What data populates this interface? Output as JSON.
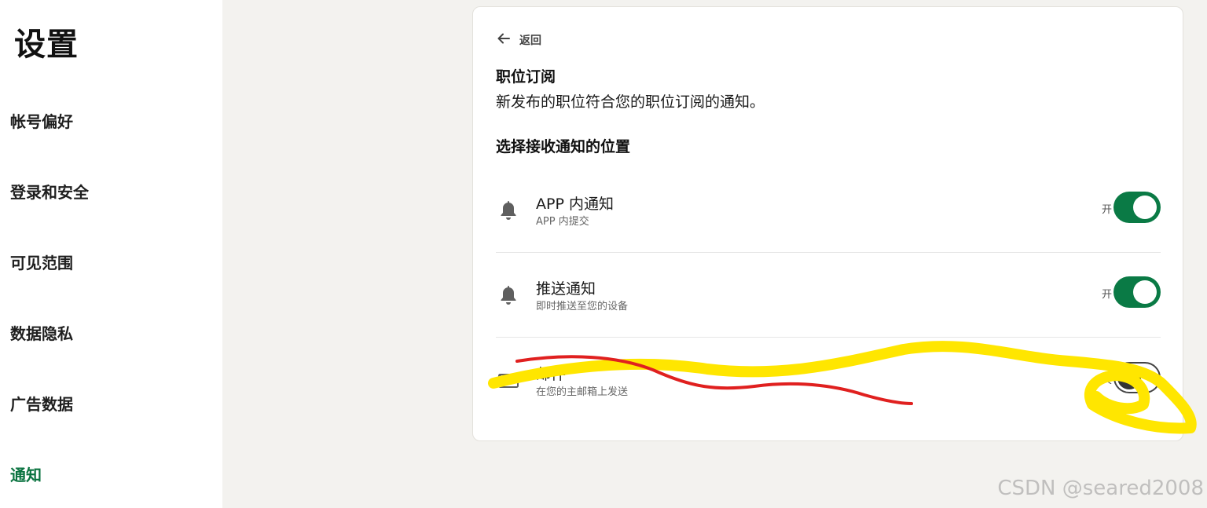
{
  "sidebar": {
    "title": "设置",
    "items": [
      {
        "label": "帐号偏好"
      },
      {
        "label": "登录和安全"
      },
      {
        "label": "可见范围"
      },
      {
        "label": "数据隐私"
      },
      {
        "label": "广告数据"
      },
      {
        "label": "通知",
        "active": true
      }
    ]
  },
  "card": {
    "back_label": "返回",
    "section_title": "职位订阅",
    "section_desc": "新发布的职位符合您的职位订阅的通知。",
    "choose_title": "选择接收通知的位置",
    "rows": [
      {
        "icon": "bell-icon",
        "title": "APP 内通知",
        "subtitle": "APP 内提交",
        "toggle_label": "开",
        "on": true
      },
      {
        "icon": "bell-icon",
        "title": "推送通知",
        "subtitle": "即时推送至您的设备",
        "toggle_label": "开",
        "on": true
      },
      {
        "icon": "mail-icon",
        "title": "邮件",
        "subtitle": "在您的主邮箱上发送",
        "toggle_label": "关",
        "on": false
      }
    ]
  },
  "watermark": "CSDN @seared2008",
  "colors": {
    "accent": "#0a7a45",
    "active_nav": "#0a7340",
    "page_bg": "#f3f2ef",
    "annotation_yellow": "#ffe600",
    "annotation_red": "#e0201f"
  }
}
